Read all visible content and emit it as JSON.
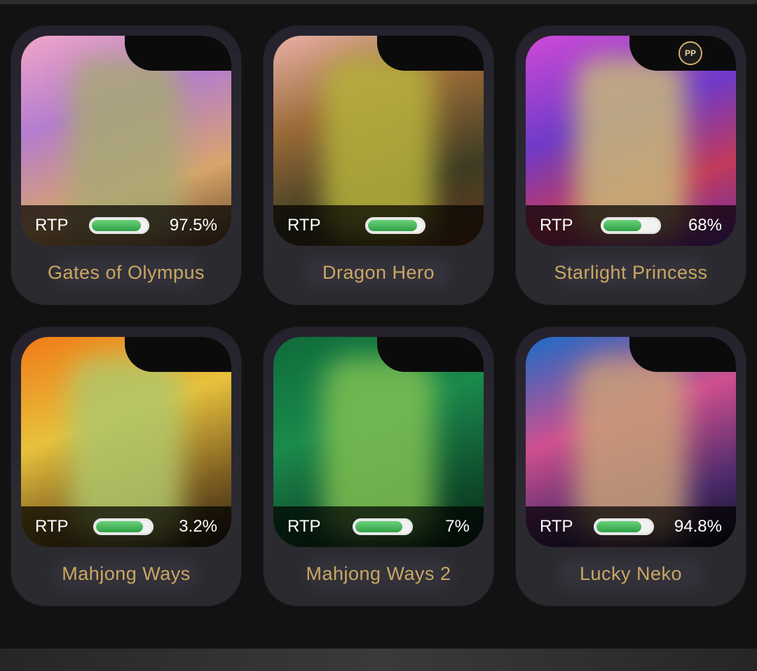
{
  "rtp_label": "RTP",
  "badge_text": "PP",
  "games": [
    {
      "title": "Gates of Olympus",
      "rtp_text": "97.5%",
      "rtp_fill": 0.9,
      "art": "linear-gradient(160deg,#f0a6c8 0%,#b57ccf 35%,#d8a56a 70%,#6a4a2e 100%)",
      "blur": "#a8a874"
    },
    {
      "title": "Dragon Hero",
      "rtp_text": "",
      "rtp_fill": 0.9,
      "art": "linear-gradient(160deg,#e9b1a6 0%,#9a6a38 35%,#3d3c22 70%,#6a3a1e 100%)",
      "blur": "#b6b23c"
    },
    {
      "title": "Starlight Princess",
      "rtp_text": "68%",
      "rtp_fill": 0.7,
      "art": "linear-gradient(160deg,#d04ad8 0%,#6f3ac8 40%,#c23a5a 70%,#6a2ea8 100%)",
      "blur": "#c8b87a"
    },
    {
      "title": "Mahjong Ways",
      "rtp_text": "3.2%",
      "rtp_fill": 0.85,
      "art": "linear-gradient(160deg,#f07a18 0%,#e8c23c 40%,#7a5a20 75%,#2a2418 100%)",
      "blur": "#b0c66a"
    },
    {
      "title": "Mahjong Ways 2",
      "rtp_text": "7%",
      "rtp_fill": 0.85,
      "art": "linear-gradient(160deg,#0f6b3a 0%,#1b8a4d 40%,#0f4e2c 75%,#0a2a18 100%)",
      "blur": "#7fbf52"
    },
    {
      "title": "Lucky Neko",
      "rtp_text": "94.8%",
      "rtp_fill": 0.82,
      "art": "linear-gradient(160deg,#1a6cc8 0%,#d04f8f 40%,#4a2a6a 75%,#10101e 100%)",
      "blur": "#c8a078"
    }
  ]
}
